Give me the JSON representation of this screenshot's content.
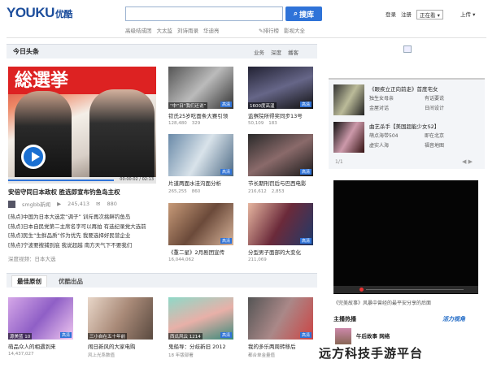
{
  "header": {
    "logo_text": "YOUKU",
    "logo_cn": "优酷",
    "search_placeholder": "",
    "search_button": "搜库",
    "hotwords": [
      "高级结成团",
      "大太监",
      "刘诗雨录",
      "华迪亮"
    ],
    "hotwords_right": [
      "排行榜",
      "影视大全"
    ],
    "top_links": [
      "登录",
      "注册",
      "正在看"
    ],
    "upload": "上传"
  },
  "section": {
    "title": "今日头条",
    "tabs": [
      "业务",
      "深度",
      "播客"
    ]
  },
  "feature": {
    "banner_text": "総選挙",
    "title": "安倍守同日本政权 胜选即宣布钓鱼岛主权",
    "source": "smgbb新闻",
    "views": "245,413",
    "comments": "880",
    "bar_time": "00:00:02 / 02:13",
    "bullets": [
      "[热点]中国为日本大选定“调子” 训斥再次挑衅钓鱼岛",
      "[热点]日本自民党第二主席名字可以再拍 有选纪录党大选前",
      "[热点]民生“生鲜品质”作为优先 我要选择好民营企业",
      "[热点]宁波要搜捕到底 我说超越 南方天气下不要我们"
    ],
    "more_source": "深度视频：日本大选"
  },
  "thumbs": [
    {
      "caption": "“中”日“我们还说”",
      "title": "钦氏25岁吃面条大赛引领",
      "views": "128,480",
      "comments": "329"
    },
    {
      "caption": "1600度高温",
      "title": "监察院所得奖同步13号",
      "views": "50,109",
      "comments": "183"
    },
    {
      "caption": "",
      "title": "片道两面水洼沟面分析",
      "views": "265,255",
      "comments": "860"
    },
    {
      "caption": "",
      "title": "节长期刑罚后与巴西电影",
      "views": "216,612",
      "comments": "2,853"
    },
    {
      "caption": "",
      "title": "《重二星》2月剧团宣传",
      "views": "16,044,062",
      "comments": ""
    },
    {
      "caption": "",
      "title": "分型男子面部的大变化",
      "views": "211,069",
      "comments": ""
    }
  ],
  "lower": {
    "tab_active": "最佳原创",
    "tab_other": "优酷出品",
    "items": [
      {
        "caption": "源美蓝 10",
        "title": "萌品众人的相遇到来",
        "meta": "14,437,027"
      },
      {
        "caption": "三小自在五十年前",
        "title": "闹日新风的大家电购",
        "meta": "风上光系数值"
      },
      {
        "caption": "西瓜风云 1214",
        "title": "鬼船导：分歧新旧 2012",
        "meta": "18 年版部署"
      },
      {
        "caption": "",
        "title": "我的多乐两周转移后",
        "meta": "都合单金量值"
      }
    ]
  },
  "right": {
    "items": [
      {
        "title": "《眼疾立正向前走》首度宅女",
        "subs": [
          "独生女母亲",
          "有话要说",
          "金屋对话",
          "日间设计"
        ]
      },
      {
        "title": "曲艺杀手【美国超能少女S2】",
        "subs": [
          "萌点海带504",
          "即在北京",
          "虚实人海",
          "福音地图"
        ]
      }
    ],
    "page": "1/1",
    "player_text": "《完美故事》风暴中曾经的最平安分享的后面",
    "publisher_head": "主播热播",
    "publisher_logo": "活力视角",
    "publisher_item": "午后故事 网络"
  },
  "watermark": "远方科技手游平台",
  "colors": {
    "brand_blue": "#1d4e9c",
    "accent": "#2f73d8",
    "logo_red": "#e8231a"
  }
}
